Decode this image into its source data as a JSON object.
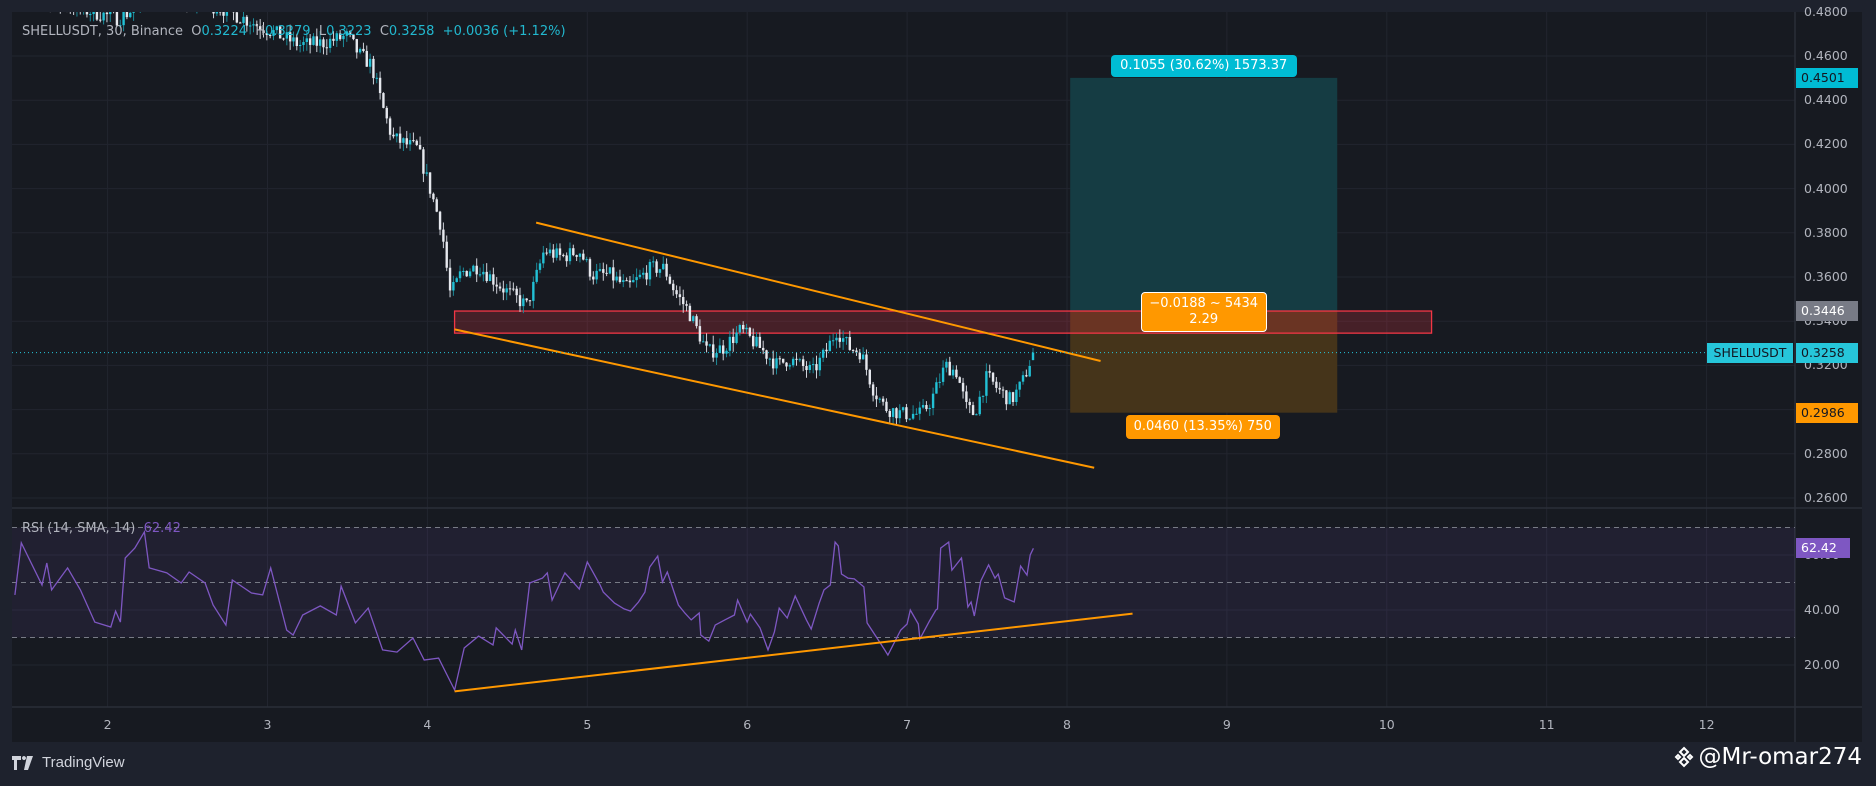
{
  "header": {
    "symbol": "SHELLUSDT, 30, Binance",
    "o_label": "O",
    "o": "0.3224",
    "h_label": "H",
    "h": "0.3279",
    "l_label": "L",
    "l": "0.3223",
    "c_label": "C",
    "c": "0.3258",
    "change": "+0.0036 (+1.12%)"
  },
  "rsi_legend": {
    "name": "RSI (14, SMA, 14)",
    "value": "62.42"
  },
  "colors": {
    "bull": "#22c1d6",
    "bear": "#e6e8ee",
    "accent": "#00bcd4",
    "orange": "#ff9800",
    "rsi": "#7e57c2",
    "zone": "#f23645",
    "target_fill": "#153c43",
    "stop_fill": "#45341a"
  },
  "price_axis": {
    "ticks": [
      "0.4800",
      "0.4600",
      "0.4400",
      "0.4200",
      "0.4000",
      "0.3800",
      "0.3600",
      "0.3400",
      "0.3200",
      "0.3000",
      "0.2800",
      "0.2600"
    ],
    "badges": [
      {
        "value": "0.4501",
        "kind": "target"
      },
      {
        "value": "0.3446",
        "kind": "entry"
      },
      {
        "value": "0.3258",
        "kind": "last"
      },
      {
        "value": "0.2986",
        "kind": "stop"
      }
    ],
    "symbol_label": "SHELLUSDT"
  },
  "rsi_axis": {
    "ticks": [
      "60.00",
      "40.00",
      "20.00"
    ],
    "badge": "62.42",
    "levels": [
      70,
      50,
      30
    ]
  },
  "time_axis": {
    "ticks": [
      "2",
      "3",
      "4",
      "5",
      "6",
      "7",
      "8",
      "9",
      "10",
      "11",
      "12"
    ]
  },
  "position": {
    "entry": 0.3446,
    "target": 0.4501,
    "stop": 0.2986,
    "start_day": 8.02,
    "end_day": 9.69,
    "target_label": "0.1055 (30.62%) 1573.37",
    "mid_label_1": "−0.0188 ~ 5434",
    "mid_label_2": "2.29",
    "stop_label": "0.0460 (13.35%) 750"
  },
  "chart_data": {
    "type": "candlestick",
    "symbol": "SHELLUSDT",
    "interval": "30",
    "exchange": "Binance",
    "ylim": [
      0.26,
      0.48
    ],
    "xlim_days": [
      1.4,
      12.6
    ],
    "last_bar": {
      "open": 0.3224,
      "high": 0.3279,
      "low": 0.3223,
      "close": 0.3258
    },
    "price_path": [
      [
        1.35,
        0.49
      ],
      [
        1.6,
        0.486
      ],
      [
        1.9,
        0.48
      ],
      [
        2.07,
        0.477
      ],
      [
        2.3,
        0.488
      ],
      [
        2.7,
        0.482
      ],
      [
        3.0,
        0.472
      ],
      [
        3.2,
        0.465
      ],
      [
        3.35,
        0.466
      ],
      [
        3.5,
        0.469
      ],
      [
        3.57,
        0.461
      ],
      [
        3.65,
        0.456
      ],
      [
        3.72,
        0.437
      ],
      [
        3.78,
        0.423
      ],
      [
        3.87,
        0.42
      ],
      [
        3.94,
        0.418
      ],
      [
        4.02,
        0.399
      ],
      [
        4.09,
        0.382
      ],
      [
        4.14,
        0.353
      ],
      [
        4.17,
        0.355
      ],
      [
        4.21,
        0.362
      ],
      [
        4.32,
        0.365
      ],
      [
        4.47,
        0.355
      ],
      [
        4.62,
        0.347
      ],
      [
        4.66,
        0.355
      ],
      [
        4.73,
        0.372
      ],
      [
        4.84,
        0.369
      ],
      [
        4.95,
        0.372
      ],
      [
        5.03,
        0.361
      ],
      [
        5.14,
        0.361
      ],
      [
        5.25,
        0.355
      ],
      [
        5.4,
        0.364
      ],
      [
        5.48,
        0.364
      ],
      [
        5.55,
        0.353
      ],
      [
        5.63,
        0.345
      ],
      [
        5.7,
        0.334
      ],
      [
        5.75,
        0.326
      ],
      [
        5.85,
        0.328
      ],
      [
        5.96,
        0.336
      ],
      [
        6.08,
        0.328
      ],
      [
        6.19,
        0.32
      ],
      [
        6.26,
        0.323
      ],
      [
        6.41,
        0.317
      ],
      [
        6.49,
        0.326
      ],
      [
        6.56,
        0.336
      ],
      [
        6.64,
        0.328
      ],
      [
        6.71,
        0.326
      ],
      [
        6.79,
        0.309
      ],
      [
        6.86,
        0.301
      ],
      [
        6.97,
        0.298
      ],
      [
        7.09,
        0.298
      ],
      [
        7.15,
        0.304
      ],
      [
        7.24,
        0.32
      ],
      [
        7.31,
        0.317
      ],
      [
        7.37,
        0.301
      ],
      [
        7.42,
        0.298
      ],
      [
        7.5,
        0.315
      ],
      [
        7.57,
        0.309
      ],
      [
        7.65,
        0.304
      ],
      [
        7.72,
        0.312
      ],
      [
        7.79,
        0.3258
      ]
    ],
    "drawings": {
      "channel_upper": [
        [
          4.68,
          0.3846
        ],
        [
          8.21,
          0.322
        ]
      ],
      "channel_lower": [
        [
          4.17,
          0.3363
        ],
        [
          8.17,
          0.2737
        ]
      ],
      "resistance_zone": {
        "top": 0.3446,
        "bottom": 0.3346,
        "start_day": 4.17,
        "end_day": 10.28
      },
      "rsi_trendline": [
        [
          4.17,
          10.4
        ],
        [
          8.41,
          38.7
        ]
      ]
    },
    "rsi": {
      "period": 14,
      "last": 62.42,
      "points": [
        [
          1.42,
          45.5
        ],
        [
          1.46,
          64.4
        ],
        [
          1.59,
          49.1
        ],
        [
          1.62,
          57.1
        ],
        [
          1.65,
          47.3
        ],
        [
          1.75,
          55.3
        ],
        [
          1.83,
          47.3
        ],
        [
          1.92,
          35.6
        ],
        [
          2.02,
          33.8
        ],
        [
          2.05,
          39.6
        ],
        [
          2.08,
          35.6
        ],
        [
          2.11,
          58.9
        ],
        [
          2.17,
          62.5
        ],
        [
          2.23,
          68.4
        ],
        [
          2.26,
          55.3
        ],
        [
          2.37,
          53.5
        ],
        [
          2.46,
          49.8
        ],
        [
          2.51,
          53.8
        ],
        [
          2.61,
          49.8
        ],
        [
          2.66,
          41.8
        ],
        [
          2.74,
          34.5
        ],
        [
          2.78,
          50.9
        ],
        [
          2.9,
          46.2
        ],
        [
          2.97,
          45.5
        ],
        [
          3.02,
          55.3
        ],
        [
          3.12,
          32.7
        ],
        [
          3.16,
          30.9
        ],
        [
          3.22,
          38.2
        ],
        [
          3.33,
          41.5
        ],
        [
          3.43,
          38.2
        ],
        [
          3.46,
          48.7
        ],
        [
          3.55,
          35.3
        ],
        [
          3.63,
          40.7
        ],
        [
          3.72,
          25.5
        ],
        [
          3.81,
          24.7
        ],
        [
          3.91,
          29.8
        ],
        [
          3.98,
          21.8
        ],
        [
          4.07,
          22.5
        ],
        [
          4.17,
          10.9
        ],
        [
          4.23,
          26.2
        ],
        [
          4.32,
          30.5
        ],
        [
          4.41,
          27.3
        ],
        [
          4.43,
          33.5
        ],
        [
          4.53,
          27.6
        ],
        [
          4.55,
          32.7
        ],
        [
          4.59,
          25.5
        ],
        [
          4.64,
          49.8
        ],
        [
          4.72,
          51.6
        ],
        [
          4.75,
          53.5
        ],
        [
          4.78,
          43.6
        ],
        [
          4.86,
          53.5
        ],
        [
          4.95,
          47.6
        ],
        [
          5.0,
          57.5
        ],
        [
          5.08,
          49.1
        ],
        [
          5.1,
          46.5
        ],
        [
          5.17,
          42.5
        ],
        [
          5.23,
          40.4
        ],
        [
          5.27,
          39.6
        ],
        [
          5.32,
          42.9
        ],
        [
          5.36,
          46.5
        ],
        [
          5.39,
          55.6
        ],
        [
          5.44,
          59.6
        ],
        [
          5.47,
          50.2
        ],
        [
          5.5,
          53.8
        ],
        [
          5.57,
          41.8
        ],
        [
          5.61,
          38.9
        ],
        [
          5.65,
          36.4
        ],
        [
          5.7,
          38.9
        ],
        [
          5.71,
          30.9
        ],
        [
          5.76,
          28.7
        ],
        [
          5.8,
          34.5
        ],
        [
          5.86,
          36.4
        ],
        [
          5.92,
          38.2
        ],
        [
          5.94,
          43.6
        ],
        [
          6.0,
          35.6
        ],
        [
          6.02,
          38.5
        ],
        [
          6.08,
          33.5
        ],
        [
          6.13,
          25.5
        ],
        [
          6.17,
          32.0
        ],
        [
          6.2,
          40.7
        ],
        [
          6.25,
          37.1
        ],
        [
          6.3,
          45.1
        ],
        [
          6.37,
          36.4
        ],
        [
          6.4,
          33.1
        ],
        [
          6.45,
          42.5
        ],
        [
          6.48,
          47.3
        ],
        [
          6.52,
          49.1
        ],
        [
          6.55,
          64.7
        ],
        [
          6.57,
          63.3
        ],
        [
          6.59,
          53.1
        ],
        [
          6.63,
          51.6
        ],
        [
          6.67,
          51.3
        ],
        [
          6.73,
          48.4
        ],
        [
          6.75,
          35.3
        ],
        [
          6.82,
          29.1
        ],
        [
          6.86,
          25.5
        ],
        [
          6.88,
          23.6
        ],
        [
          6.96,
          32.7
        ],
        [
          7.0,
          34.9
        ],
        [
          7.02,
          40.0
        ],
        [
          7.07,
          34.9
        ],
        [
          7.08,
          29.5
        ],
        [
          7.14,
          36.0
        ],
        [
          7.18,
          40.0
        ],
        [
          7.19,
          40.4
        ],
        [
          7.21,
          62.5
        ],
        [
          7.26,
          64.7
        ],
        [
          7.28,
          54.5
        ],
        [
          7.34,
          58.9
        ],
        [
          7.36,
          50.5
        ],
        [
          7.38,
          41.1
        ],
        [
          7.4,
          42.9
        ],
        [
          7.42,
          37.8
        ],
        [
          7.46,
          50.5
        ],
        [
          7.51,
          56.4
        ],
        [
          7.55,
          51.6
        ],
        [
          7.57,
          53.1
        ],
        [
          7.61,
          44.4
        ],
        [
          7.67,
          42.9
        ],
        [
          7.71,
          56.0
        ],
        [
          7.75,
          52.7
        ],
        [
          7.77,
          60.0
        ],
        [
          7.79,
          62.42
        ]
      ]
    }
  },
  "footer": {
    "brand": "TradingView",
    "watermark": "@Mr-omar274"
  }
}
